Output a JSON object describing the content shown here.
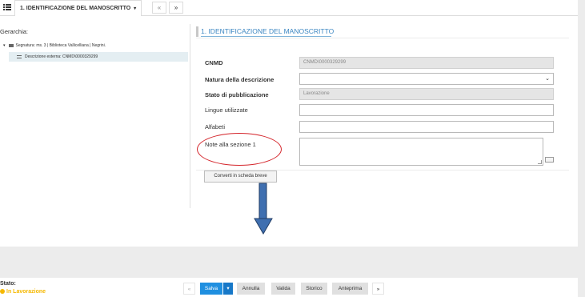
{
  "tabs": {
    "menu_icon": "list-menu-icon",
    "active_label": "1. IDENTIFICAZIONE DEL MANOSCRITTO",
    "active_caret": "▾",
    "prev": "«",
    "next": "»"
  },
  "tree": {
    "title": "Gerarchia:",
    "root_toggle": "▾",
    "root_label": "Segnatura: ms. 3 | Biblioteca Vallicelliana | Negrini.",
    "child_label": "Descrizione esterna: CNMD\\0000329299"
  },
  "form": {
    "section_title": "1. IDENTIFICAZIONE DEL MANOSCRITTO",
    "cnmd_label": "CNMD",
    "cnmd_value": "CNMD\\0000329299",
    "natura_label": "Natura della descrizione",
    "natura_value": "",
    "natura_chevron": "⌄",
    "stato_pub_label": "Stato di pubblicazione",
    "stato_pub_value": "Lavorazione",
    "lingue_label": "Lingue utilizzate",
    "lingue_value": "",
    "alfabeti_label": "Alfabeti",
    "alfabeti_value": "",
    "note_label": "Note alla sezione 1",
    "note_value": "",
    "convert_button": "Converti in scheda breve"
  },
  "annotation": {
    "ellipse_color": "#d4252b",
    "arrow_color": "#3f6fb0"
  },
  "status": {
    "label": "Stato:",
    "value": "In Lavorazione",
    "color": "#f5b800"
  },
  "actions": {
    "prev": "«",
    "save": "Salva",
    "save_dropdown": "▾",
    "cancel": "Annulla",
    "validate": "Valida",
    "history": "Storico",
    "preview": "Anteprima",
    "next": "»"
  }
}
